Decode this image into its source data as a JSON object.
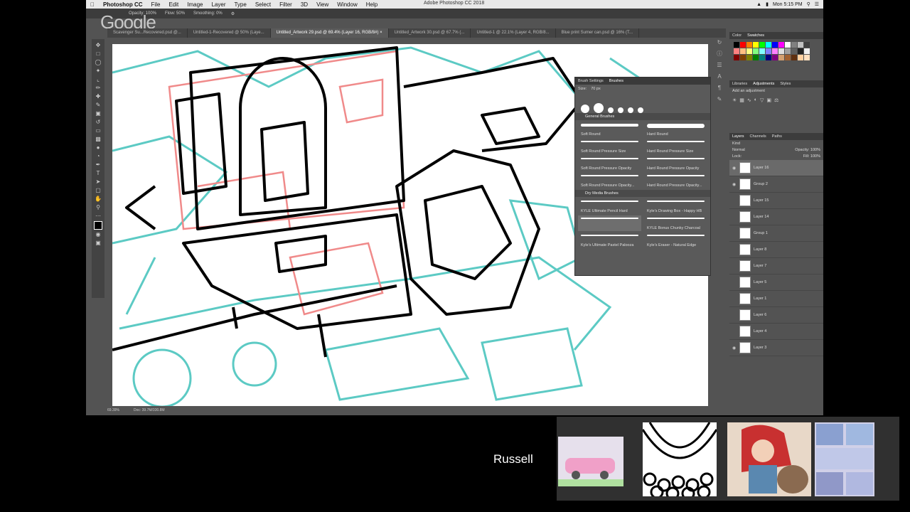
{
  "menubar": {
    "app_name": "Photoshop CC",
    "items": [
      "File",
      "Edit",
      "Image",
      "Layer",
      "Type",
      "Select",
      "Filter",
      "3D",
      "View",
      "Window",
      "Help"
    ],
    "window_title": "Adobe Photoshop CC 2018",
    "clock": "Mon 5:15 PM"
  },
  "watermark": "Google",
  "options_bar": {
    "opacity": "Opacity: 100%",
    "flow": "Flow: 50%",
    "smoothing": "Smoothing: 0%"
  },
  "tabs": [
    "Scavenger Su...Recovered.psd @...",
    "Untitled-1-Recovered @ 50% (Laye...",
    "Untitled_Artwork 29.psd @ 69.4% (Layer 16, RGB/8#) ×",
    "Untitled_Artwork 30.psd @ 67.7% (...",
    "Untitled-1 @ 22.1% (Layer 4, RGB/8...",
    "Blue print Sumer can.psd @ 16% (T..."
  ],
  "status": {
    "zoom": "69.39%",
    "doc": "Doc: 39.7M/330.8M"
  },
  "brushes_panel": {
    "tabs": [
      "Brush Settings",
      "Brushes"
    ],
    "size": "70 px",
    "tip_sizes": [
      "10",
      "30",
      "9",
      "30",
      "60",
      "212"
    ],
    "group1": "General Brushes",
    "group1_items": [
      "Soft Round",
      "Hard Round",
      "Soft Round Pressure Size",
      "Hard Round Pressure Size",
      "Soft Round Pressure Opacity",
      "Hard Round Pressure Opacity",
      "Soft Round Pressure Opacity...",
      "Hard Round Pressure Opacity..."
    ],
    "group2": "Dry Media Brushes",
    "group2_items": [
      "KYLE Ultimate Pencil Hard",
      "Kyle's Drawing Box - Happy HB",
      "",
      "KYLE Bonus Chunky Charcoal",
      "Kyle's Ultimate Pastel Palooza",
      "Kyle's Eraser - Natural Edge"
    ]
  },
  "right_dock": {
    "color_tabs": [
      "Color",
      "Swatches"
    ],
    "adj_tabs": [
      "Libraries",
      "Adjustments",
      "Styles"
    ],
    "adj_hint": "Add an adjustment",
    "layer_tabs": [
      "Layers",
      "Channels",
      "Paths"
    ],
    "kind": "Kind",
    "blend": "Normal",
    "opacity": "Opacity: 100%",
    "lock": "Lock:",
    "fill": "Fill: 100%",
    "layers": [
      {
        "name": "Layer 16",
        "selected": true,
        "visible": true
      },
      {
        "name": "Group 2",
        "selected": false,
        "visible": true
      },
      {
        "name": "Layer 15",
        "selected": false,
        "visible": false
      },
      {
        "name": "Layer 14",
        "selected": false,
        "visible": false
      },
      {
        "name": "Group 1",
        "selected": false,
        "visible": false
      },
      {
        "name": "Layer 8",
        "selected": false,
        "visible": false
      },
      {
        "name": "Layer 7",
        "selected": false,
        "visible": false
      },
      {
        "name": "Layer 5",
        "selected": false,
        "visible": false
      },
      {
        "name": "Layer 1",
        "selected": false,
        "visible": false
      },
      {
        "name": "Layer 6",
        "selected": false,
        "visible": false
      },
      {
        "name": "Layer 4",
        "selected": false,
        "visible": false
      },
      {
        "name": "Layer 3",
        "selected": false,
        "visible": true
      }
    ]
  },
  "swatch_colors": [
    "#000000",
    "#ff0000",
    "#ff7f00",
    "#ffff00",
    "#00ff00",
    "#00ffff",
    "#0000ff",
    "#ff00ff",
    "#ffffff",
    "#808080",
    "#c0c0c0",
    "#404040",
    "#ff8080",
    "#ffbf80",
    "#ffff80",
    "#80ff80",
    "#80ffff",
    "#8080ff",
    "#ff80ff",
    "#e0e0e0",
    "#a0a0a0",
    "#606060",
    "#202020",
    "#f0f0f0",
    "#800000",
    "#804000",
    "#808000",
    "#008000",
    "#008080",
    "#000080",
    "#800080",
    "#d4a070",
    "#a06030",
    "#603010",
    "#ffd0a0",
    "#ffe0c0"
  ],
  "webcam": {
    "name": "Russell"
  }
}
